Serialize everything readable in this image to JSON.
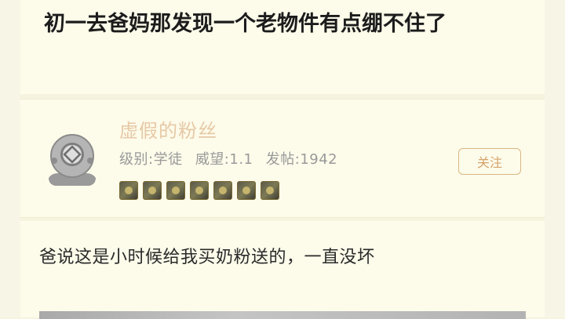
{
  "post": {
    "title": "初一去爸妈那发现一个老物件有点绷不住了",
    "body_text": "爸说这是小时候给我买奶粉送的，一直没坏"
  },
  "user": {
    "name": "虚假的粉丝",
    "level": "级别:学徒",
    "prestige": "威望:1.1",
    "posts": "发帖:1942",
    "follow_label": "关注",
    "medal_count": 7
  },
  "colors": {
    "background": "#fdfbea",
    "username": "#e6c9a6",
    "follow_accent": "#d4a36a"
  },
  "icons": [
    "diver-helmet-avatar-icon",
    "medal-icon"
  ]
}
